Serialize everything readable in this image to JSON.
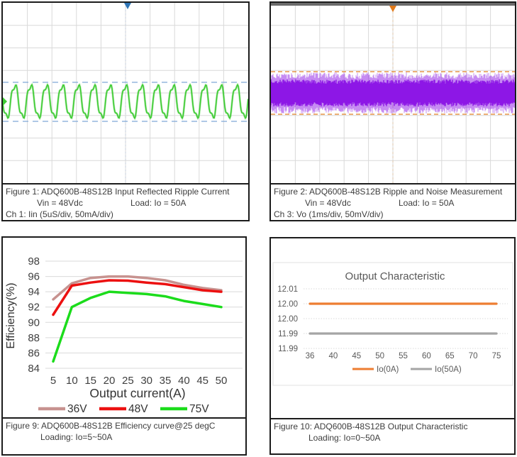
{
  "figure1": {
    "title": "Figure 1: ADQ600B-48S12B Input Reflected Ripple Current",
    "vin": "Vin = 48Vdc",
    "load": "Load: Io = 50A",
    "channel": "Ch 1: Iin (5uS/div, 50mA/div)"
  },
  "figure2": {
    "title": "Figure 2: ADQ600B-48S12B Ripple and Noise Measurement",
    "vin": "Vin = 48Vdc",
    "load": "Load: Io = 50A",
    "channel": "Ch 3: Vo (1ms/div, 50mV/div)"
  },
  "figure9": {
    "title": "Figure 9: ADQ600B-48S12B Efficiency curve@25 degC",
    "loading": "Loading: Io=5~50A"
  },
  "figure10": {
    "title": "Figure 10: ADQ600B-48S12B Output Characteristic",
    "loading": "Loading: Io=0~50A"
  },
  "chart_data": [
    {
      "id": "figure1_scope",
      "type": "line",
      "subtype": "oscilloscope",
      "channel": "Ch 1: Iin",
      "timebase": "5uS/div",
      "scale": "50mA/div",
      "divisions_x": 10,
      "divisions_y": 8,
      "cycles_visible": 15.5,
      "peak_to_peak_divisions": 1.7,
      "annotations": "dashed cursor lines at waveform peak and trough; trigger marker at top center",
      "trace_color": "#3ecb33",
      "cursor_color": "#7fa8d8",
      "trigger_color": "#2e75b6",
      "grid_color": "#d9d9d9"
    },
    {
      "id": "figure2_scope",
      "type": "line",
      "subtype": "oscilloscope",
      "channel": "Ch 3: Vo",
      "timebase": "1ms/div",
      "scale": "50mV/div",
      "divisions_x": 10,
      "divisions_y": 8,
      "band_peak_to_peak_divisions": 1.8,
      "annotations": "dense noise band centered slightly above mid-screen; dashed cursor lines at band top and bottom; trigger marker at top center",
      "trace_color": "#8d17e6",
      "cursor_color": "#e08125",
      "trigger_color": "#e07818",
      "grid_color": "#d9d9d9",
      "top_bar_color": "#6b6b6b"
    },
    {
      "id": "figure9_efficiency",
      "type": "line",
      "title": "",
      "xlabel": "Output current(A)",
      "ylabel": "Efficiency(%)",
      "x": [
        5,
        10,
        15,
        20,
        25,
        30,
        35,
        40,
        45,
        50
      ],
      "ylim": [
        84,
        98
      ],
      "yticks": [
        84,
        86,
        88,
        90,
        92,
        94,
        96,
        98
      ],
      "grid": true,
      "legend_position": "bottom",
      "series": [
        {
          "name": "36V",
          "color": "#c7928f",
          "values": [
            93,
            95.1,
            95.8,
            96.0,
            96.0,
            95.8,
            95.5,
            94.9,
            94.5,
            94.2
          ]
        },
        {
          "name": "48V",
          "color": "#ec1010",
          "values": [
            91,
            94.8,
            95.2,
            95.5,
            95.45,
            95.2,
            95.0,
            94.6,
            94.2,
            94.0
          ]
        },
        {
          "name": "75V",
          "color": "#1bdc1b",
          "values": [
            84.9,
            92.0,
            93.2,
            94.0,
            93.85,
            93.7,
            93.4,
            92.8,
            92.4,
            92.0
          ]
        }
      ]
    },
    {
      "id": "figure10_output_characteristic",
      "type": "line",
      "title": "Output Characteristic",
      "x": [
        36,
        40,
        45,
        50,
        55,
        60,
        65,
        70,
        75
      ],
      "ytick_labels": [
        "12.01",
        "12.00",
        "12.00",
        "11.99",
        "11.99"
      ],
      "grid": true,
      "legend_position": "bottom",
      "series": [
        {
          "name": "Io(0A)",
          "color": "#ed7d31",
          "values": [
            12.0,
            12.0,
            12.0,
            12.0,
            12.0,
            12.0,
            12.0,
            12.0,
            12.0
          ],
          "grid_level": 1
        },
        {
          "name": "Io(50A)",
          "color": "#a5a5a5",
          "values": [
            11.99,
            11.99,
            11.99,
            11.99,
            11.99,
            11.99,
            11.99,
            11.99,
            11.99
          ],
          "grid_level": 3
        }
      ],
      "text_color": "#595959"
    }
  ]
}
